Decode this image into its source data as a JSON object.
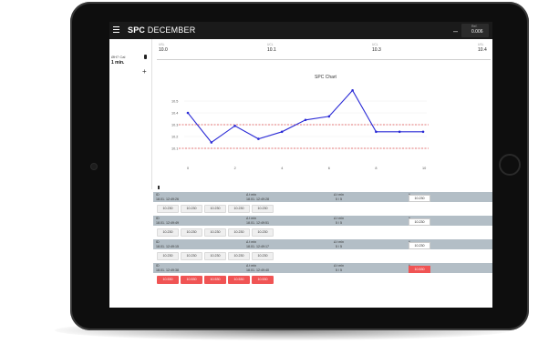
{
  "app": {
    "title_bold": "SPC",
    "title_rest": " DECEMBER",
    "kpi_label": "Ref.",
    "kpi_dash": "–",
    "kpi_value": "0.006"
  },
  "scale": [
    {
      "tag": "USL",
      "value": "10.0"
    },
    {
      "tag": "UCL",
      "value": "10.1"
    },
    {
      "tag": "UCL",
      "value": "10.3"
    },
    {
      "tag": "USL",
      "value": "10.4"
    }
  ],
  "side": {
    "label": "ØH7 Cal",
    "value": "1 min.",
    "plus": "+"
  },
  "chart_data": {
    "type": "line",
    "title": "SPC Chart",
    "x": [
      1,
      2,
      3,
      4,
      5,
      6,
      7,
      8,
      9,
      10,
      11
    ],
    "series": [
      {
        "values": [
          10.4,
          10.15,
          10.29,
          10.18,
          10.24,
          10.34,
          10.37,
          10.59,
          10.24,
          10.24,
          10.24
        ],
        "color": "#2b2bd6"
      }
    ],
    "limits": [
      {
        "value": 10.3,
        "color": "#e05050",
        "style": "dashed"
      },
      {
        "value": 10.1,
        "color": "#e05050",
        "style": "dashed"
      }
    ],
    "ylim": [
      10.0,
      10.6
    ],
    "yticks": [
      "10.5",
      "10.4",
      "10.3",
      "10.2",
      "10.1"
    ],
    "xticks": [
      "0",
      "2",
      "4",
      "6",
      "8",
      "10"
    ],
    "grid": true
  },
  "table": {
    "col_labels": [
      "ID",
      "Δ t min",
      "Δ t min",
      "x̄"
    ],
    "rows": [
      {
        "id": "",
        "date": "18.01. 12:49:26",
        "time": "18.01. 12:49:28",
        "count": "5 / 5",
        "result": "10.230",
        "result_color": "#ffffff",
        "alarm": false,
        "values": [
          "10.230",
          "10.230",
          "10.230",
          "10.230",
          "10.230"
        ]
      },
      {
        "id": "",
        "date": "18.01. 12:49:49",
        "time": "18.01. 12:49:51",
        "count": "5 / 5",
        "result": "10.230",
        "result_color": "#ffffff",
        "alarm": false,
        "values": [
          "10.230",
          "10.230",
          "10.230",
          "10.230",
          "10.230"
        ]
      },
      {
        "id": "",
        "date": "18.01. 12:49:15",
        "time": "18.01. 12:49:17",
        "count": "5 / 5",
        "result": "10.230",
        "result_color": "#ffffff",
        "alarm": false,
        "values": [
          "10.230",
          "10.230",
          "10.230",
          "10.230",
          "10.230"
        ]
      },
      {
        "id": "",
        "date": "18.01. 12:49:38",
        "time": "18.01. 12:49:40",
        "count": "5 / 5",
        "result": "10.530",
        "result_color": "#f05454",
        "alarm": true,
        "values": [
          "10.530",
          "10.530",
          "10.530",
          "10.530",
          "10.530"
        ]
      }
    ]
  }
}
